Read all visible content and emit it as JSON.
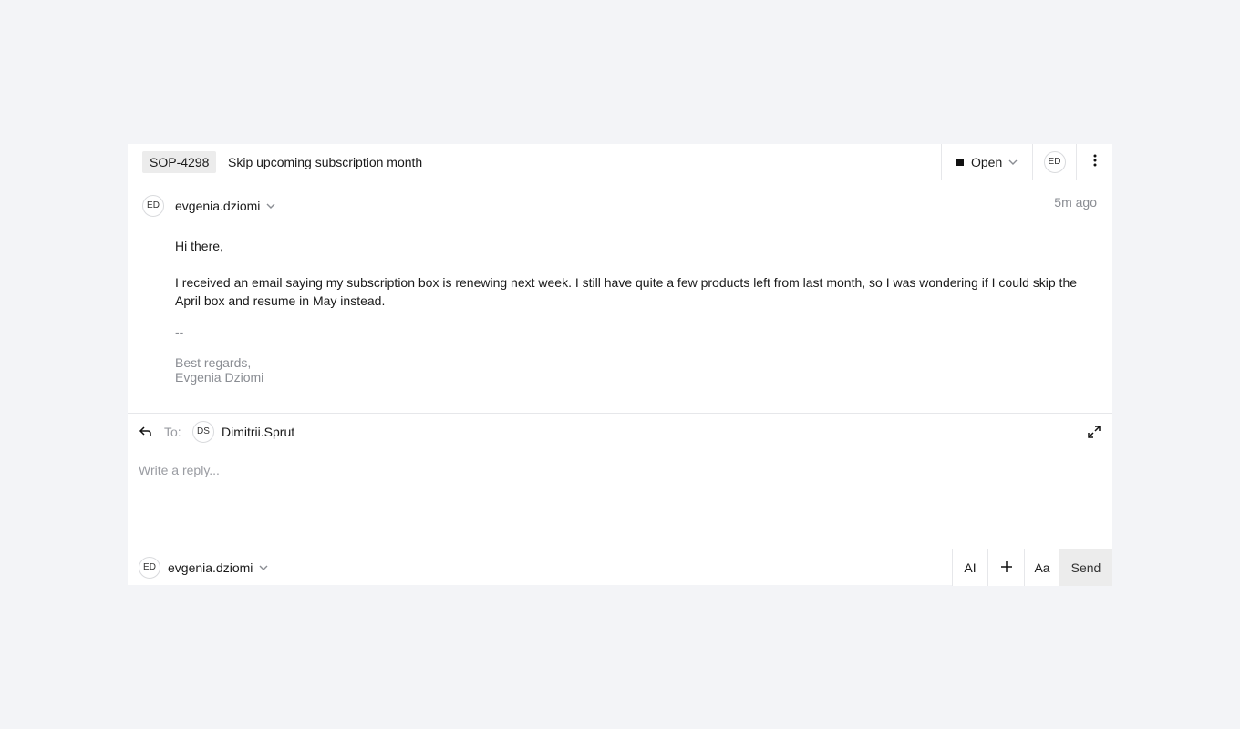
{
  "ticket": {
    "id": "SOP-4298",
    "title": "Skip upcoming subscription month",
    "status": "Open",
    "assignee_initials": "ED"
  },
  "message": {
    "sender_initials": "ED",
    "sender": "evgenia.dziomi",
    "timestamp": "5m ago",
    "greeting": "Hi there,",
    "body": "I received an email saying my subscription box is renewing next week. I still have quite a few products left from last month, so I was wondering if I could skip the April box and resume in May instead.",
    "signature_separator": "--",
    "signature_line1": "Best regards,",
    "signature_line2": "Evgenia Dziomi"
  },
  "reply": {
    "to_label": "To:",
    "recipient_initials": "DS",
    "recipient": "Dimitrii.Sprut",
    "placeholder": "Write a reply..."
  },
  "footer": {
    "from_initials": "ED",
    "from": "evgenia.dziomi",
    "ai_label": "AI",
    "format_label": "Aa",
    "send_label": "Send"
  },
  "icons": {
    "reply": "reply-arrow-icon",
    "expand": "expand-icon",
    "more": "more-vertical-icon",
    "chevron": "chevron-down-icon",
    "add": "plus-icon"
  }
}
